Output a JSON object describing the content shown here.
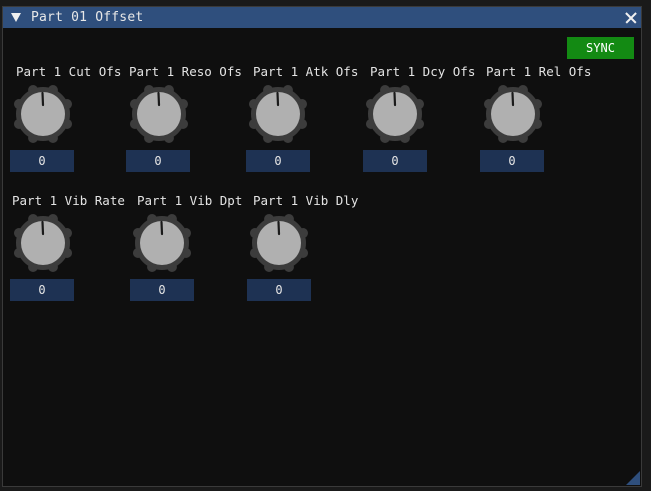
{
  "window": {
    "title": "Part 01 Offset",
    "sync_label": "SYNC",
    "colors": {
      "titlebar": "#2f4f7d",
      "sync": "#138a13",
      "value_box": "#1e3253",
      "knob_face": "#b0b0b0",
      "knob_ring": "#3c3c3c"
    }
  },
  "knobs": [
    {
      "label": "Part 1 Cut Ofs",
      "value": "0"
    },
    {
      "label": "Part 1 Reso Ofs",
      "value": "0"
    },
    {
      "label": "Part 1 Atk Ofs",
      "value": "0"
    },
    {
      "label": "Part 1 Dcy Ofs",
      "value": "0"
    },
    {
      "label": "Part 1 Rel Ofs",
      "value": "0"
    },
    {
      "label": "Part 1 Vib Rate",
      "value": "0"
    },
    {
      "label": "Part 1 Vib Dpt",
      "value": "0"
    },
    {
      "label": "Part 1 Vib Dly",
      "value": "0"
    }
  ]
}
